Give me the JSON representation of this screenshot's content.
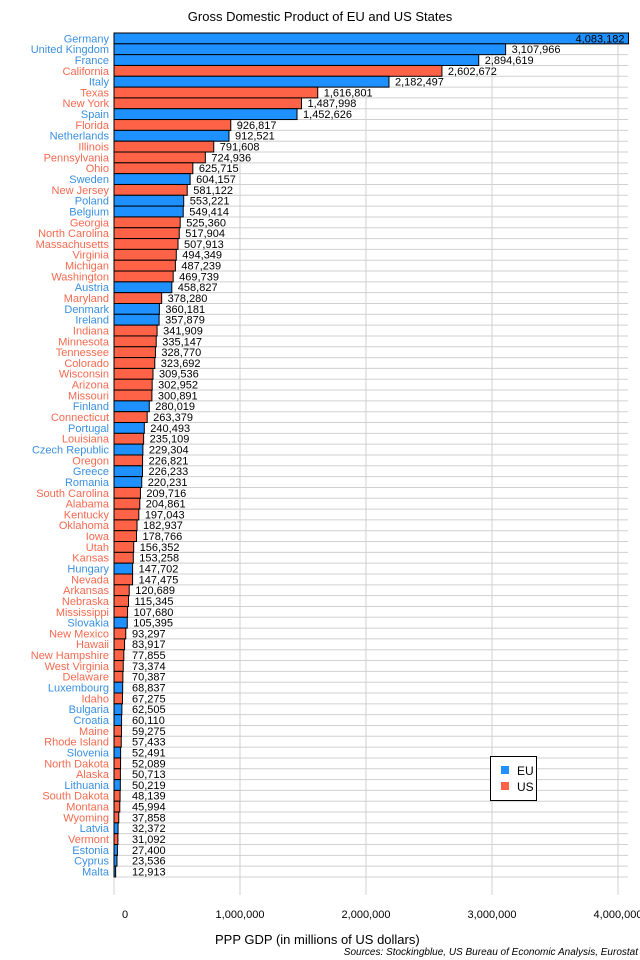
{
  "chart_data": {
    "type": "bar",
    "orientation": "horizontal",
    "title": "Gross Domestic Product of EU and US States",
    "xlabel": "PPP GDP (in millions of US dollars)",
    "ylabel": "",
    "source": "Sources: Stockingblue, US Bureau of Economic Analysis, Eurostat",
    "xlim": [
      0,
      4083182
    ],
    "xticks": [
      0,
      1000000,
      2000000,
      3000000,
      4000000
    ],
    "xtick_labels": [
      "0",
      "1,000,000",
      "2,000,000",
      "3,000,000",
      "4,000,000"
    ],
    "grid": true,
    "legend": {
      "placement": "bottom-right",
      "entries": [
        {
          "name": "EU",
          "color": "#1e90ff"
        },
        {
          "name": "US",
          "color": "#ff6347"
        }
      ]
    },
    "colors": {
      "EU": "#1e90ff",
      "US": "#ff6347",
      "EU_label": "#3a8fe0",
      "US_label": "#f46a50"
    },
    "rows": [
      {
        "name": "Germany",
        "group": "EU",
        "value": 4083182,
        "label": "4,083,182"
      },
      {
        "name": "United Kingdom",
        "group": "EU",
        "value": 3107966,
        "label": "3,107,966"
      },
      {
        "name": "France",
        "group": "EU",
        "value": 2894619,
        "label": "2,894,619"
      },
      {
        "name": "California",
        "group": "US",
        "value": 2602672,
        "label": "2,602,672"
      },
      {
        "name": "Italy",
        "group": "EU",
        "value": 2182497,
        "label": "2,182,497"
      },
      {
        "name": "Texas",
        "group": "US",
        "value": 1616801,
        "label": "1,616,801"
      },
      {
        "name": "New York",
        "group": "US",
        "value": 1487998,
        "label": "1,487,998"
      },
      {
        "name": "Spain",
        "group": "EU",
        "value": 1452626,
        "label": "1,452,626"
      },
      {
        "name": "Florida",
        "group": "US",
        "value": 926817,
        "label": "926,817"
      },
      {
        "name": "Netherlands",
        "group": "EU",
        "value": 912521,
        "label": "912,521"
      },
      {
        "name": "Illinois",
        "group": "US",
        "value": 791608,
        "label": "791,608"
      },
      {
        "name": "Pennsylvania",
        "group": "US",
        "value": 724936,
        "label": "724,936"
      },
      {
        "name": "Ohio",
        "group": "US",
        "value": 625715,
        "label": "625,715"
      },
      {
        "name": "Sweden",
        "group": "EU",
        "value": 604157,
        "label": "604,157"
      },
      {
        "name": "New Jersey",
        "group": "US",
        "value": 581122,
        "label": "581,122"
      },
      {
        "name": "Poland",
        "group": "EU",
        "value": 553221,
        "label": "553,221"
      },
      {
        "name": "Belgium",
        "group": "EU",
        "value": 549414,
        "label": "549,414"
      },
      {
        "name": "Georgia",
        "group": "US",
        "value": 525360,
        "label": "525,360"
      },
      {
        "name": "North Carolina",
        "group": "US",
        "value": 517904,
        "label": "517,904"
      },
      {
        "name": "Massachusetts",
        "group": "US",
        "value": 507913,
        "label": "507,913"
      },
      {
        "name": "Virginia",
        "group": "US",
        "value": 494349,
        "label": "494,349"
      },
      {
        "name": "Michigan",
        "group": "US",
        "value": 487239,
        "label": "487,239"
      },
      {
        "name": "Washington",
        "group": "US",
        "value": 469739,
        "label": "469,739"
      },
      {
        "name": "Austria",
        "group": "EU",
        "value": 458827,
        "label": "458,827"
      },
      {
        "name": "Maryland",
        "group": "US",
        "value": 378280,
        "label": "378,280"
      },
      {
        "name": "Denmark",
        "group": "EU",
        "value": 360181,
        "label": "360,181"
      },
      {
        "name": "Ireland",
        "group": "EU",
        "value": 357879,
        "label": "357,879"
      },
      {
        "name": "Indiana",
        "group": "US",
        "value": 341909,
        "label": "341,909"
      },
      {
        "name": "Minnesota",
        "group": "US",
        "value": 335147,
        "label": "335,147"
      },
      {
        "name": "Tennessee",
        "group": "US",
        "value": 328770,
        "label": "328,770"
      },
      {
        "name": "Colorado",
        "group": "US",
        "value": 323692,
        "label": "323,692"
      },
      {
        "name": "Wisconsin",
        "group": "US",
        "value": 309536,
        "label": "309,536"
      },
      {
        "name": "Arizona",
        "group": "US",
        "value": 302952,
        "label": "302,952"
      },
      {
        "name": "Missouri",
        "group": "US",
        "value": 300891,
        "label": "300,891"
      },
      {
        "name": "Finland",
        "group": "EU",
        "value": 280019,
        "label": "280,019"
      },
      {
        "name": "Connecticut",
        "group": "US",
        "value": 263379,
        "label": "263,379"
      },
      {
        "name": "Portugal",
        "group": "EU",
        "value": 240493,
        "label": "240,493"
      },
      {
        "name": "Louisiana",
        "group": "US",
        "value": 235109,
        "label": "235,109"
      },
      {
        "name": "Czech Republic",
        "group": "EU",
        "value": 229304,
        "label": "229,304"
      },
      {
        "name": "Oregon",
        "group": "US",
        "value": 226821,
        "label": "226,821"
      },
      {
        "name": "Greece",
        "group": "EU",
        "value": 226233,
        "label": "226,233"
      },
      {
        "name": "Romania",
        "group": "EU",
        "value": 220231,
        "label": "220,231"
      },
      {
        "name": "South Carolina",
        "group": "US",
        "value": 209716,
        "label": "209,716"
      },
      {
        "name": "Alabama",
        "group": "US",
        "value": 204861,
        "label": "204,861"
      },
      {
        "name": "Kentucky",
        "group": "US",
        "value": 197043,
        "label": "197,043"
      },
      {
        "name": "Oklahoma",
        "group": "US",
        "value": 182937,
        "label": "182,937"
      },
      {
        "name": "Iowa",
        "group": "US",
        "value": 178766,
        "label": "178,766"
      },
      {
        "name": "Utah",
        "group": "US",
        "value": 156352,
        "label": "156,352"
      },
      {
        "name": "Kansas",
        "group": "US",
        "value": 153258,
        "label": "153,258"
      },
      {
        "name": "Hungary",
        "group": "EU",
        "value": 147702,
        "label": "147,702"
      },
      {
        "name": "Nevada",
        "group": "US",
        "value": 147475,
        "label": "147,475"
      },
      {
        "name": "Arkansas",
        "group": "US",
        "value": 120689,
        "label": "120,689"
      },
      {
        "name": "Nebraska",
        "group": "US",
        "value": 115345,
        "label": "115,345"
      },
      {
        "name": "Mississippi",
        "group": "US",
        "value": 107680,
        "label": "107,680"
      },
      {
        "name": "Slovakia",
        "group": "EU",
        "value": 105395,
        "label": "105,395"
      },
      {
        "name": "New Mexico",
        "group": "US",
        "value": 93297,
        "label": "93,297"
      },
      {
        "name": "Hawaii",
        "group": "US",
        "value": 83917,
        "label": "83,917"
      },
      {
        "name": "New Hampshire",
        "group": "US",
        "value": 77855,
        "label": "77,855"
      },
      {
        "name": "West Virginia",
        "group": "US",
        "value": 73374,
        "label": "73,374"
      },
      {
        "name": "Delaware",
        "group": "US",
        "value": 70387,
        "label": "70,387"
      },
      {
        "name": "Luxembourg",
        "group": "EU",
        "value": 68837,
        "label": "68,837"
      },
      {
        "name": "Idaho",
        "group": "US",
        "value": 67275,
        "label": "67,275"
      },
      {
        "name": "Bulgaria",
        "group": "EU",
        "value": 62505,
        "label": "62,505"
      },
      {
        "name": "Croatia",
        "group": "EU",
        "value": 60110,
        "label": "60,110"
      },
      {
        "name": "Maine",
        "group": "US",
        "value": 59275,
        "label": "59,275"
      },
      {
        "name": "Rhode Island",
        "group": "US",
        "value": 57433,
        "label": "57,433"
      },
      {
        "name": "Slovenia",
        "group": "EU",
        "value": 52491,
        "label": "52,491"
      },
      {
        "name": "North Dakota",
        "group": "US",
        "value": 52089,
        "label": "52,089"
      },
      {
        "name": "Alaska",
        "group": "US",
        "value": 50713,
        "label": "50,713"
      },
      {
        "name": "Lithuania",
        "group": "EU",
        "value": 50219,
        "label": "50,219"
      },
      {
        "name": "South Dakota",
        "group": "US",
        "value": 48139,
        "label": "48,139"
      },
      {
        "name": "Montana",
        "group": "US",
        "value": 45994,
        "label": "45,994"
      },
      {
        "name": "Wyoming",
        "group": "US",
        "value": 37858,
        "label": "37,858"
      },
      {
        "name": "Latvia",
        "group": "EU",
        "value": 32372,
        "label": "32,372"
      },
      {
        "name": "Vermont",
        "group": "US",
        "value": 31092,
        "label": "31,092"
      },
      {
        "name": "Estonia",
        "group": "EU",
        "value": 27400,
        "label": "27,400"
      },
      {
        "name": "Cyprus",
        "group": "EU",
        "value": 23536,
        "label": "23,536"
      },
      {
        "name": "Malta",
        "group": "EU",
        "value": 12913,
        "label": "12,913"
      }
    ]
  }
}
